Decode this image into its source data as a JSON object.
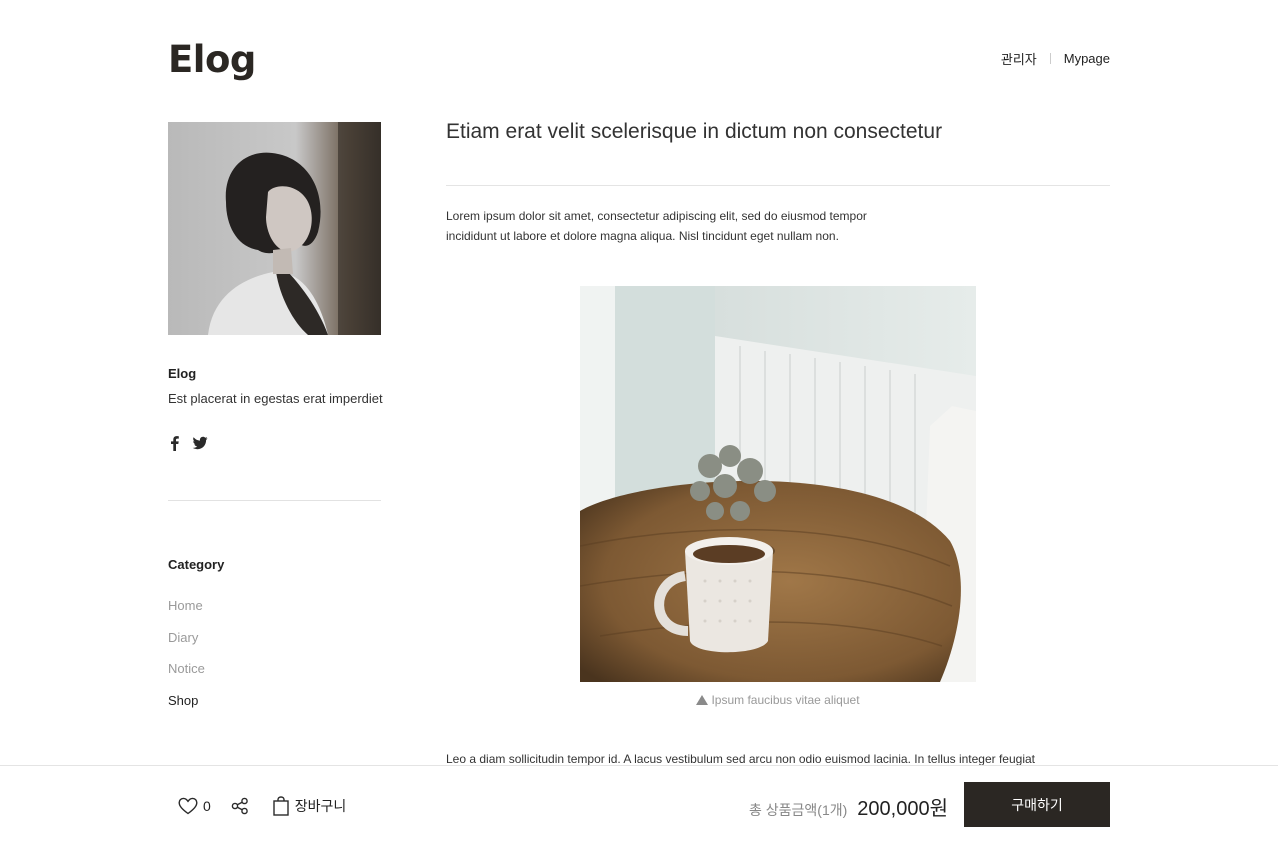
{
  "header": {
    "logo": "Elog",
    "nav": [
      "관리자",
      "Mypage"
    ]
  },
  "profile": {
    "name": "Elog",
    "description": "Est placerat in egestas erat imperdiet"
  },
  "category": {
    "title": "Category",
    "items": [
      "Home",
      "Diary",
      "Notice",
      "Shop"
    ],
    "active": "Shop"
  },
  "post": {
    "title": "Etiam erat velit scelerisque in dictum non consectetur",
    "intro": "Lorem ipsum dolor sit amet, consectetur adipiscing elit, sed do eiusmod tempor incididunt ut labore et dolore magna aliqua. Nisl tincidunt eget nullam non.",
    "caption": "Ipsum faucibus vitae aliquet",
    "body": "Leo a diam sollicitudin tempor id. A lacus vestibulum sed arcu non odio euismod lacinia. In tellus integer feugiat"
  },
  "bottom_bar": {
    "like_count": "0",
    "cart_label": "장바구니",
    "total_label": "총 상품금액(1개)",
    "total_price": "200,000원",
    "buy_label": "구매하기"
  },
  "colors": {
    "brand_dark": "#2b2723",
    "muted_text": "#9a9a9a",
    "divider": "#e4e4e4"
  }
}
